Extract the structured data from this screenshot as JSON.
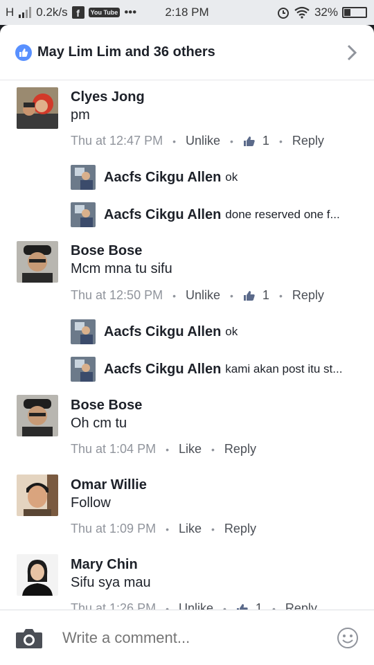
{
  "status_bar": {
    "signal": "H",
    "speed": "0.2k/s",
    "fb_letter": "f",
    "yt_label": "You Tube",
    "more": "•••",
    "time": "2:18 PM",
    "battery": "32%"
  },
  "header": {
    "title": "May Lim Lim and 36 others",
    "accent": "#5890ff"
  },
  "comments": [
    {
      "name": "Clyes Jong",
      "text": "pm",
      "time": "Thu at 12:47 PM",
      "action": "Unlike",
      "likes": "1",
      "reply": "Reply",
      "replies": [
        {
          "name": "Aacfs Cikgu Allen",
          "text": "ok"
        },
        {
          "name": "Aacfs Cikgu Allen",
          "text": "done reserved one f..."
        }
      ]
    },
    {
      "name": "Bose Bose",
      "text": "Mcm mna tu sifu",
      "time": "Thu at 12:50 PM",
      "action": "Unlike",
      "likes": "1",
      "reply": "Reply",
      "replies": [
        {
          "name": "Aacfs Cikgu Allen",
          "text": "ok"
        },
        {
          "name": "Aacfs Cikgu Allen",
          "text": "kami akan post itu st..."
        }
      ]
    },
    {
      "name": "Bose Bose",
      "text": "Oh cm tu",
      "time": "Thu at 1:04 PM",
      "action": "Like",
      "reply": "Reply"
    },
    {
      "name": "Omar Willie",
      "text": "Follow",
      "time": "Thu at 1:09 PM",
      "action": "Like",
      "reply": "Reply"
    },
    {
      "name": "Mary Chin",
      "text": "Sifu sya mau",
      "time": "Thu at 1:26 PM",
      "action": "Unlike",
      "likes": "1",
      "reply": "Reply"
    }
  ],
  "composer": {
    "placeholder": "Write a comment..."
  }
}
